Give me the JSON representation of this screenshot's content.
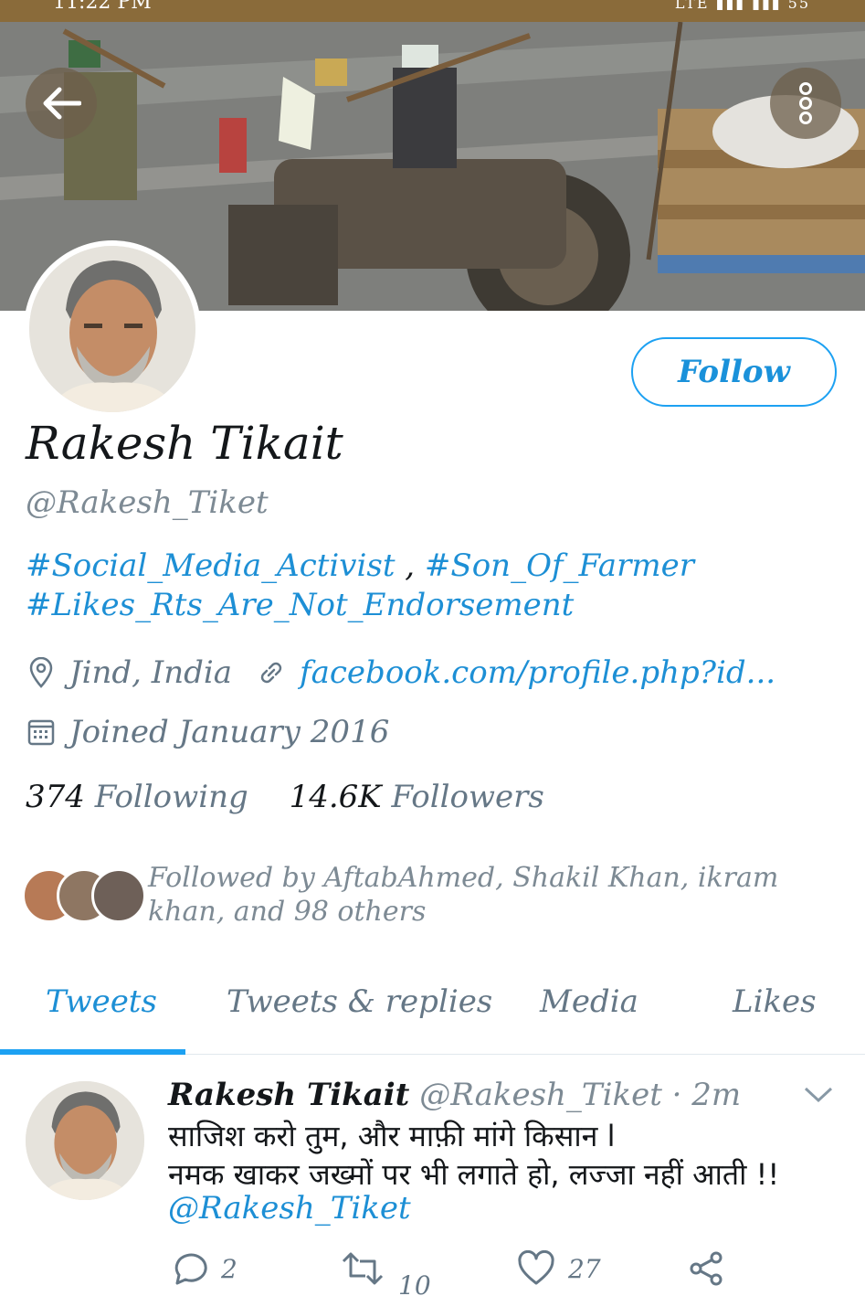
{
  "status_bar": {
    "time": "11:22 PM",
    "indicators": "LTE ▮▮▮ ▮▮▮ 55"
  },
  "header": {
    "back_icon": "arrow-left-icon",
    "more_icon": "more-vertical-icon"
  },
  "profile": {
    "name": "Rakesh Tikait",
    "handle": "@Rakesh_Tiket",
    "follow_label": "Follow",
    "bio": {
      "tag1": "#Social_Media_Activist",
      "separator": " , ",
      "tag2": "#Son_Of_Farmer",
      "tag3": "#Likes_Rts_Are_Not_Endorsement"
    },
    "location": "Jind, India",
    "website": "facebook.com/profile.php?id...",
    "joined": "Joined January 2016",
    "following_count": "374",
    "following_label": "Following",
    "followers_count": "14.6K",
    "followers_label": "Followers",
    "followed_by": "Followed by AftabAhmed, Shakil Khan, ikram khan, and 98 others"
  },
  "tabs": [
    {
      "label": "Tweets",
      "active": true
    },
    {
      "label": "Tweets & replies",
      "active": false
    },
    {
      "label": "Media",
      "active": false
    },
    {
      "label": "Likes",
      "active": false
    }
  ],
  "tweet": {
    "name": "Rakesh Tikait",
    "handle_time": "@Rakesh_Tiket · 2m",
    "line1": "साजिश करो तुम, और माफ़ी मांगे किसान l",
    "line2": "नमक खाकर जख्मों पर भी लगाते हो, लज्जा नहीं आती !!",
    "mention": "@Rakesh_Tiket",
    "replies": "2",
    "retweets": "10",
    "likes": "27"
  },
  "colors": {
    "accent": "#1da1f2",
    "link": "#1d8fd5",
    "muted": "#657786",
    "status_bar": "#8a6b3a"
  }
}
